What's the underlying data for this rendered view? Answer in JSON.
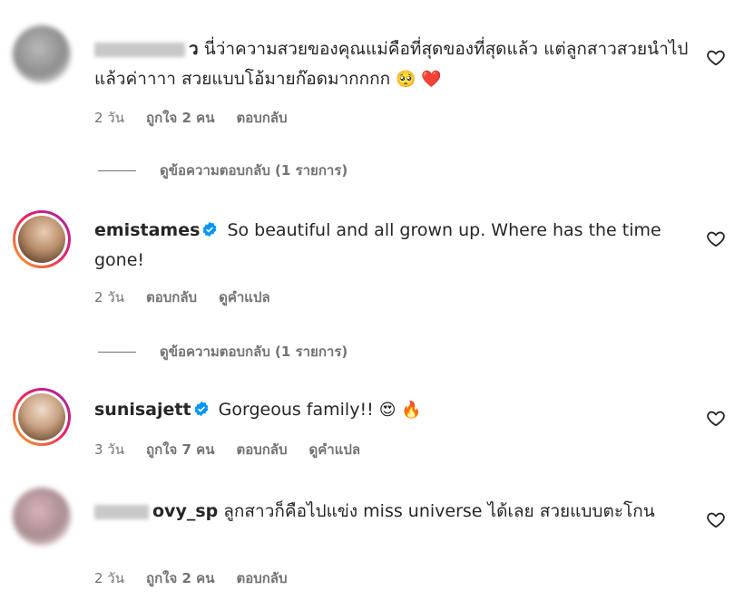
{
  "comments": [
    {
      "username_visible": "ว",
      "text": "นี่ว่าความสวยของคุณแม่คือที่สุดของที่สุดแล้ว แต่ลูกสาวสวยนำไปแล้วค่าาาา สวยแบบโอ้มายก๊อดมากกกก",
      "emojis": "🥺 ❤️",
      "time": "2 วัน",
      "likes": "ถูกใจ 2 คน",
      "reply": "ตอบกลับ",
      "view_replies": "ดูข้อความตอบกลับ (1 รายการ)"
    },
    {
      "username": "emistames",
      "text": "So beautiful and all grown up. Where has the time gone!",
      "time": "2 วัน",
      "reply": "ตอบกลับ",
      "translate": "ดูคำแปล",
      "view_replies": "ดูข้อความตอบกลับ (1 รายการ)"
    },
    {
      "username": "sunisajett",
      "text": "Gorgeous family!!",
      "emojis": "😍 🔥",
      "time": "3 วัน",
      "likes": "ถูกใจ 7 คน",
      "reply": "ตอบกลับ",
      "translate": "ดูคำแปล"
    },
    {
      "username_visible": "ovy_sp",
      "text": "ลูกสาวก็คือไปแข่ง miss universe ได้เลย สวยแบบตะโกน",
      "time": "2 วัน",
      "likes": "ถูกใจ 2 คน",
      "reply": "ตอบกลับ"
    }
  ],
  "colors": {
    "text": "#262626",
    "meta": "#737373",
    "verified": "#0095f6",
    "heart_outline": "#262626"
  }
}
